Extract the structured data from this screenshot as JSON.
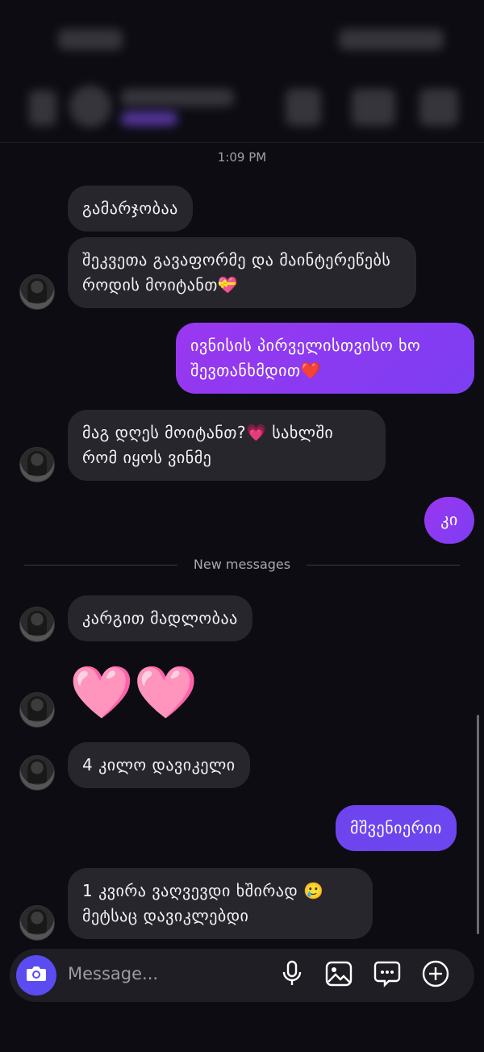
{
  "conversation": {
    "timestamp": "1:09 PM",
    "divider_label": "New messages",
    "messages": [
      {
        "side": "received",
        "text": "გამარჯობაა"
      },
      {
        "side": "received",
        "text": "შეკვეთა გავაფორმე და მაინტერეწებს როდის მოიტანთ💝"
      },
      {
        "side": "sent",
        "text": "ივნისის პირველისთვისო ხო შევთანხმდით❤️"
      },
      {
        "side": "received",
        "text": "მაგ დღეს მოიტანთ?💗 სახლში რომ იყოს ვინმე"
      },
      {
        "side": "sent",
        "text": "კი"
      },
      {
        "side": "received",
        "text": "კარგით მადლობაა"
      },
      {
        "side": "received",
        "text": "🩷🩷"
      },
      {
        "side": "received",
        "text": "4 კილო დავიკელი"
      },
      {
        "side": "sent",
        "text": "მშვენიერიი"
      },
      {
        "side": "received",
        "text": "1 კვირა ვაღვევდი ხშირად 🥲 მეტსაც დავიკლებდი"
      }
    ]
  },
  "composer": {
    "placeholder": "Message...",
    "icons": [
      "camera-icon",
      "microphone-icon",
      "gallery-icon",
      "sticker-icon",
      "plus-icon"
    ]
  },
  "colors": {
    "background": "#0c0c12",
    "received_bubble": "#26262c",
    "sent_bubble_start": "#9a37f0",
    "sent_bubble_end": "#6b47ee",
    "accent": "#5a4cf0"
  }
}
